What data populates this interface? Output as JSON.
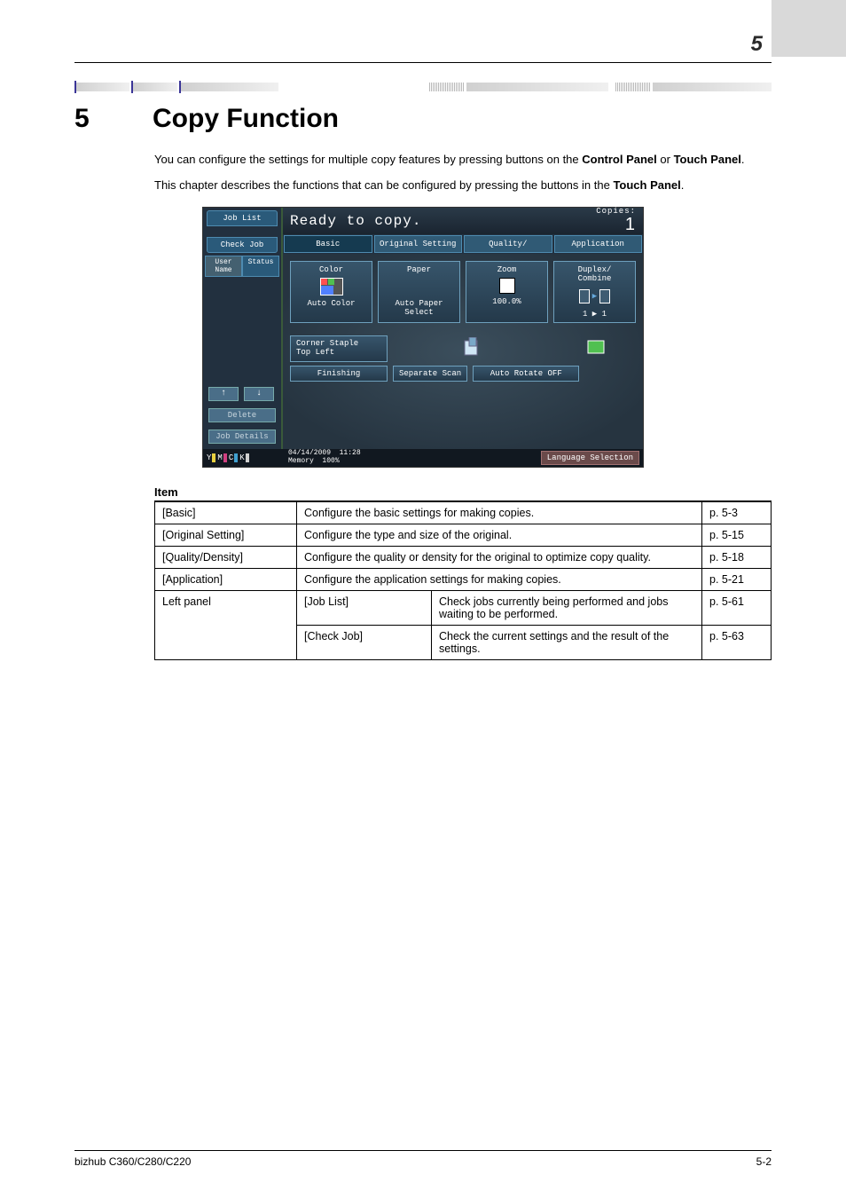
{
  "header": {
    "section_number": "5"
  },
  "h1": {
    "number": "5",
    "title": "Copy Function"
  },
  "para1_a": "You can configure the settings for multiple copy features by pressing buttons on the ",
  "para1_b": "Control Panel",
  "para1_c": " or ",
  "para1_d": "Touch Panel",
  "para1_e": ".",
  "para2_a": "This chapter describes the functions that can be configured by pressing the buttons in the ",
  "para2_b": "Touch Panel",
  "para2_c": ".",
  "panel": {
    "job_list_tab": "Job List",
    "check_job_tab": "Check Job",
    "status_msg": "Ready to copy.",
    "copies_label": "Copies:",
    "copies_value": "1",
    "tabs": {
      "basic": "Basic",
      "original": "Original Setting",
      "quality": "Quality/\nDensity",
      "application": "Application"
    },
    "left": {
      "sub1": "User\nName",
      "sub2": "Status",
      "up": "↑",
      "down": "↓",
      "delete": "Delete",
      "details": "Job Details"
    },
    "boxes": {
      "color_lbl": "Color",
      "color_val": "Auto Color",
      "paper_lbl": "Paper",
      "paper_val": "Auto Paper\nSelect",
      "zoom_lbl": "Zoom",
      "zoom_val": "100.0%",
      "duplex_lbl": "Duplex/\nCombine",
      "duplex_val": "1 ▶ 1"
    },
    "corner": "Corner Staple\nTop Left",
    "finishing": "Finishing",
    "sep_scan": "Separate Scan",
    "auto_rotate": "Auto Rotate OFF",
    "footer": {
      "Y": "Y",
      "M": "M",
      "C": "C",
      "K": "K",
      "date": "04/14/2009",
      "time": "11:28",
      "mem_lbl": "Memory",
      "mem_val": "100%",
      "lang": "Language Selection"
    }
  },
  "table": {
    "heading": "Item",
    "rows": {
      "basic_item": "[Basic]",
      "basic_desc": "Configure the basic settings for making copies.",
      "basic_pg": "p. 5-3",
      "orig_item": "[Original Setting]",
      "orig_desc": "Configure the type and size of the original.",
      "orig_pg": "p. 5-15",
      "qd_item": "[Quality/Density]",
      "qd_desc": "Configure the quality or density for the original to optimize copy quality.",
      "qd_pg": "p. 5-18",
      "app_item": "[Application]",
      "app_desc": "Configure the application settings for making copies.",
      "app_pg": "p. 5-21",
      "lp_item": "Left panel",
      "jl_sub": "[Job List]",
      "jl_desc": "Check jobs currently being performed and jobs waiting to be performed.",
      "jl_pg": "p. 5-61",
      "cj_sub": "[Check Job]",
      "cj_desc": "Check the current settings and the result of the settings.",
      "cj_pg": "p. 5-63"
    }
  },
  "footer": {
    "model": "bizhub C360/C280/C220",
    "page": "5-2"
  }
}
